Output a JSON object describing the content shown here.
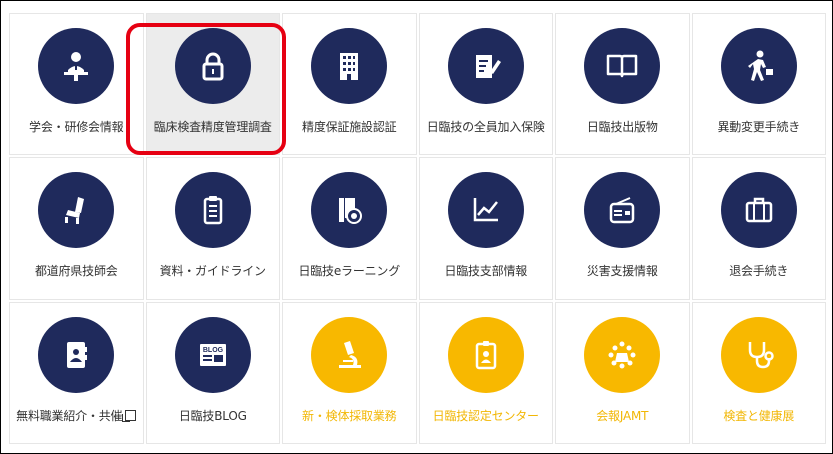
{
  "colors": {
    "navy": "#1f2a5c",
    "gold": "#f8b800",
    "highlight_border": "#e60012"
  },
  "tiles": [
    {
      "label": "学会・研修会情報",
      "icon": "lecturer-icon",
      "theme": "navy"
    },
    {
      "label": "臨床検査精度管理調査",
      "icon": "padlock-icon",
      "theme": "navy",
      "selected": true
    },
    {
      "label": "精度保証施設認証",
      "icon": "building-icon",
      "theme": "navy"
    },
    {
      "label": "日臨技の全員加入保険",
      "icon": "document-pen-icon",
      "theme": "navy"
    },
    {
      "label": "日臨技出版物",
      "icon": "book-icon",
      "theme": "navy"
    },
    {
      "label": "異動変更手続き",
      "icon": "walking-businessman-icon",
      "theme": "navy"
    },
    {
      "label": "都道府県技師会",
      "icon": "chair-icon",
      "theme": "navy"
    },
    {
      "label": "資料・ガイドライン",
      "icon": "clipboard-icon",
      "theme": "navy"
    },
    {
      "label": "日臨技eラーニング",
      "icon": "media-disc-icon",
      "theme": "navy"
    },
    {
      "label": "日臨技支部情報",
      "icon": "chart-icon",
      "theme": "navy"
    },
    {
      "label": "災害支援情報",
      "icon": "radio-icon",
      "theme": "navy"
    },
    {
      "label": "退会手続き",
      "icon": "briefcase-icon",
      "theme": "navy"
    },
    {
      "label": "無料職業紹介・共催",
      "icon": "contact-book-icon",
      "theme": "navy",
      "external": true
    },
    {
      "label": "日臨技BLOG",
      "icon": "blog-icon",
      "theme": "navy",
      "blog_text": "BLOG"
    },
    {
      "label": "新・検体採取業務",
      "icon": "microscope-icon",
      "theme": "gold"
    },
    {
      "label": "日臨技認定センター",
      "icon": "id-badge-icon",
      "theme": "gold"
    },
    {
      "label": "会報JAMT",
      "icon": "conference-icon",
      "theme": "gold"
    },
    {
      "label": "検査と健康展",
      "icon": "stethoscope-icon",
      "theme": "gold"
    }
  ]
}
